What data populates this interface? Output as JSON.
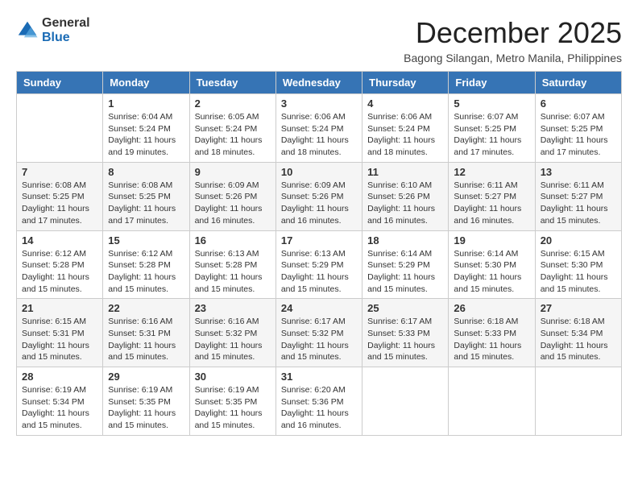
{
  "logo": {
    "general": "General",
    "blue": "Blue"
  },
  "title": "December 2025",
  "location": "Bagong Silangan, Metro Manila, Philippines",
  "weekdays": [
    "Sunday",
    "Monday",
    "Tuesday",
    "Wednesday",
    "Thursday",
    "Friday",
    "Saturday"
  ],
  "weeks": [
    [
      {
        "day": "",
        "info": ""
      },
      {
        "day": "1",
        "info": "Sunrise: 6:04 AM\nSunset: 5:24 PM\nDaylight: 11 hours and 19 minutes."
      },
      {
        "day": "2",
        "info": "Sunrise: 6:05 AM\nSunset: 5:24 PM\nDaylight: 11 hours and 18 minutes."
      },
      {
        "day": "3",
        "info": "Sunrise: 6:06 AM\nSunset: 5:24 PM\nDaylight: 11 hours and 18 minutes."
      },
      {
        "day": "4",
        "info": "Sunrise: 6:06 AM\nSunset: 5:24 PM\nDaylight: 11 hours and 18 minutes."
      },
      {
        "day": "5",
        "info": "Sunrise: 6:07 AM\nSunset: 5:25 PM\nDaylight: 11 hours and 17 minutes."
      },
      {
        "day": "6",
        "info": "Sunrise: 6:07 AM\nSunset: 5:25 PM\nDaylight: 11 hours and 17 minutes."
      }
    ],
    [
      {
        "day": "7",
        "info": "Sunrise: 6:08 AM\nSunset: 5:25 PM\nDaylight: 11 hours and 17 minutes."
      },
      {
        "day": "8",
        "info": "Sunrise: 6:08 AM\nSunset: 5:25 PM\nDaylight: 11 hours and 17 minutes."
      },
      {
        "day": "9",
        "info": "Sunrise: 6:09 AM\nSunset: 5:26 PM\nDaylight: 11 hours and 16 minutes."
      },
      {
        "day": "10",
        "info": "Sunrise: 6:09 AM\nSunset: 5:26 PM\nDaylight: 11 hours and 16 minutes."
      },
      {
        "day": "11",
        "info": "Sunrise: 6:10 AM\nSunset: 5:26 PM\nDaylight: 11 hours and 16 minutes."
      },
      {
        "day": "12",
        "info": "Sunrise: 6:11 AM\nSunset: 5:27 PM\nDaylight: 11 hours and 16 minutes."
      },
      {
        "day": "13",
        "info": "Sunrise: 6:11 AM\nSunset: 5:27 PM\nDaylight: 11 hours and 15 minutes."
      }
    ],
    [
      {
        "day": "14",
        "info": "Sunrise: 6:12 AM\nSunset: 5:28 PM\nDaylight: 11 hours and 15 minutes."
      },
      {
        "day": "15",
        "info": "Sunrise: 6:12 AM\nSunset: 5:28 PM\nDaylight: 11 hours and 15 minutes."
      },
      {
        "day": "16",
        "info": "Sunrise: 6:13 AM\nSunset: 5:28 PM\nDaylight: 11 hours and 15 minutes."
      },
      {
        "day": "17",
        "info": "Sunrise: 6:13 AM\nSunset: 5:29 PM\nDaylight: 11 hours and 15 minutes."
      },
      {
        "day": "18",
        "info": "Sunrise: 6:14 AM\nSunset: 5:29 PM\nDaylight: 11 hours and 15 minutes."
      },
      {
        "day": "19",
        "info": "Sunrise: 6:14 AM\nSunset: 5:30 PM\nDaylight: 11 hours and 15 minutes."
      },
      {
        "day": "20",
        "info": "Sunrise: 6:15 AM\nSunset: 5:30 PM\nDaylight: 11 hours and 15 minutes."
      }
    ],
    [
      {
        "day": "21",
        "info": "Sunrise: 6:15 AM\nSunset: 5:31 PM\nDaylight: 11 hours and 15 minutes."
      },
      {
        "day": "22",
        "info": "Sunrise: 6:16 AM\nSunset: 5:31 PM\nDaylight: 11 hours and 15 minutes."
      },
      {
        "day": "23",
        "info": "Sunrise: 6:16 AM\nSunset: 5:32 PM\nDaylight: 11 hours and 15 minutes."
      },
      {
        "day": "24",
        "info": "Sunrise: 6:17 AM\nSunset: 5:32 PM\nDaylight: 11 hours and 15 minutes."
      },
      {
        "day": "25",
        "info": "Sunrise: 6:17 AM\nSunset: 5:33 PM\nDaylight: 11 hours and 15 minutes."
      },
      {
        "day": "26",
        "info": "Sunrise: 6:18 AM\nSunset: 5:33 PM\nDaylight: 11 hours and 15 minutes."
      },
      {
        "day": "27",
        "info": "Sunrise: 6:18 AM\nSunset: 5:34 PM\nDaylight: 11 hours and 15 minutes."
      }
    ],
    [
      {
        "day": "28",
        "info": "Sunrise: 6:19 AM\nSunset: 5:34 PM\nDaylight: 11 hours and 15 minutes."
      },
      {
        "day": "29",
        "info": "Sunrise: 6:19 AM\nSunset: 5:35 PM\nDaylight: 11 hours and 15 minutes."
      },
      {
        "day": "30",
        "info": "Sunrise: 6:19 AM\nSunset: 5:35 PM\nDaylight: 11 hours and 15 minutes."
      },
      {
        "day": "31",
        "info": "Sunrise: 6:20 AM\nSunset: 5:36 PM\nDaylight: 11 hours and 16 minutes."
      },
      {
        "day": "",
        "info": ""
      },
      {
        "day": "",
        "info": ""
      },
      {
        "day": "",
        "info": ""
      }
    ]
  ]
}
